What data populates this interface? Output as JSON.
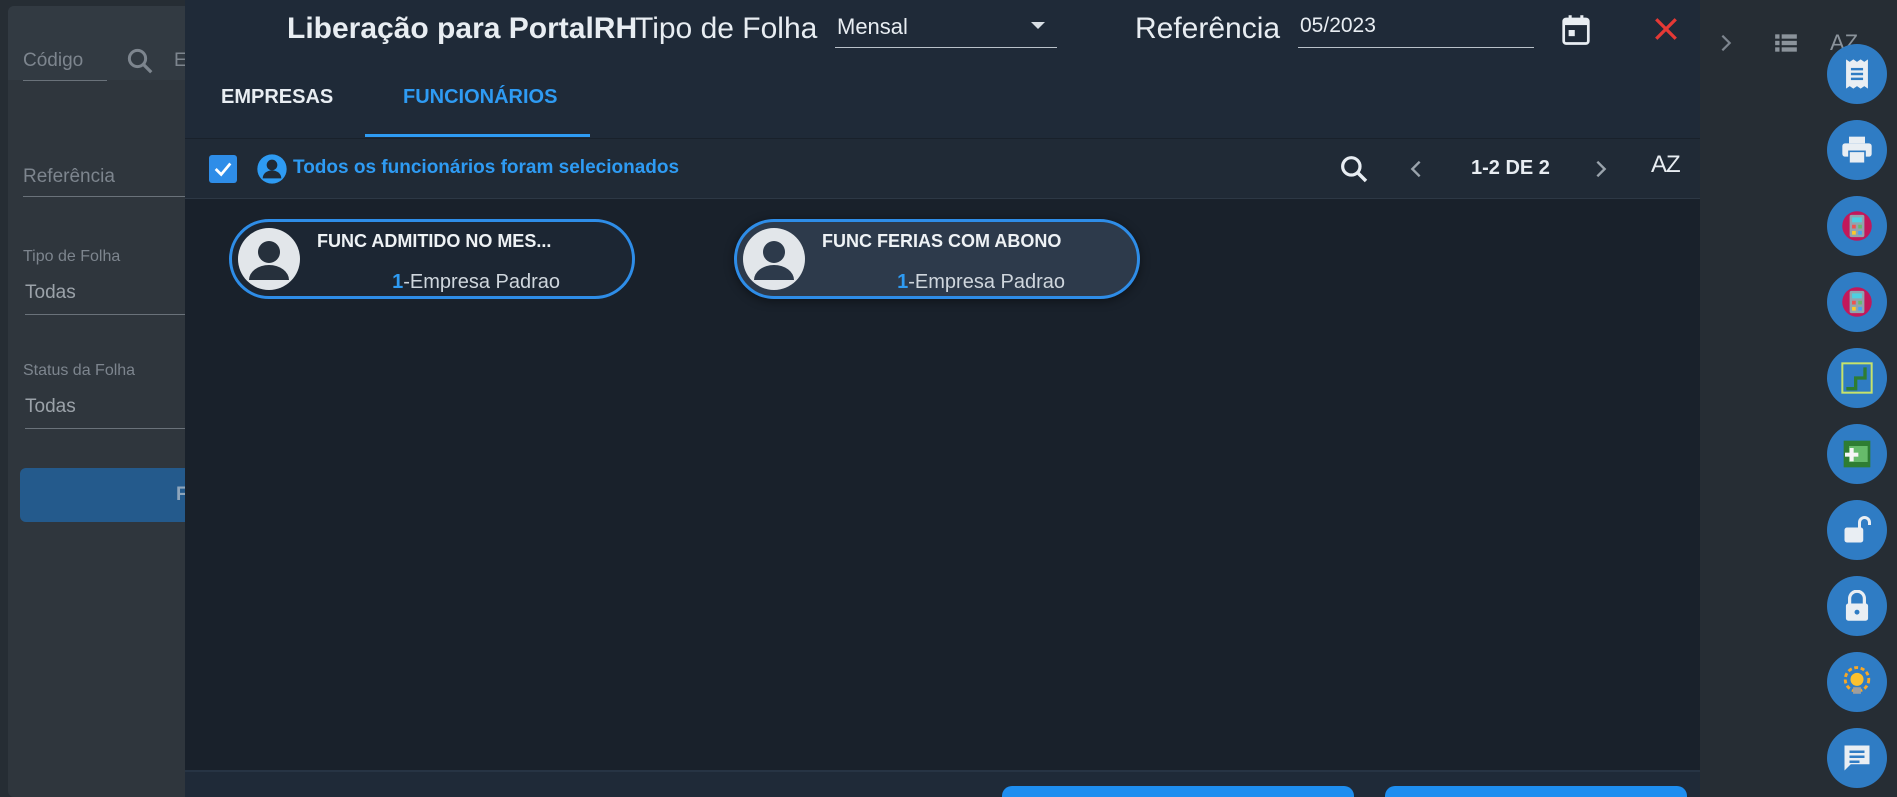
{
  "background": {
    "codigo_placeholder": "Código",
    "search_letter": "E",
    "referencia_placeholder": "Referência",
    "tipo_label": "Tipo de Folha",
    "tipo_value": "Todas",
    "status_label": "Status da Folha",
    "status_value": "Todas",
    "button_letter": "F",
    "sort_label": "AZ"
  },
  "modal": {
    "title": "Liberação para PortalRH",
    "tipo_label": "Tipo de Folha",
    "tipo_value": "Mensal",
    "ref_label": "Referência",
    "ref_value": "05/2023",
    "tabs": [
      {
        "label": "EMPRESAS"
      },
      {
        "label": "FUNCIONÁRIOS"
      }
    ],
    "selection_text": "Todos os funcionários foram selecionados",
    "pager": "1-2 DE 2",
    "sort_label": "AZ",
    "cards": [
      {
        "name": "FUNC ADMITIDO NO MES...",
        "code": "1",
        "company": "-Empresa Padrao"
      },
      {
        "name": "FUNC FERIAS COM ABONO",
        "code": "1",
        "company": "-Empresa Padrao"
      }
    ]
  },
  "colors": {
    "accent": "#2e9bf3",
    "close": "#e53935",
    "fab": "#2f7cc4"
  },
  "fab_icons": [
    "receipt-icon",
    "print-icon",
    "calculator-icon",
    "calculator-icon",
    "step-icon",
    "add-box-icon",
    "lock-open-icon",
    "lock-icon",
    "lightbulb-gear-icon",
    "chat-icon"
  ]
}
